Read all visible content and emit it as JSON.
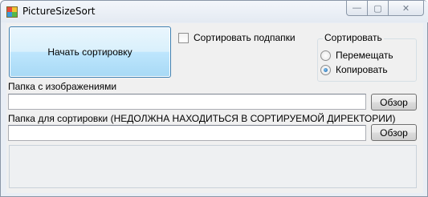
{
  "window": {
    "title": "PictureSizeSort",
    "minimize_glyph": "—",
    "maximize_glyph": "▢",
    "close_glyph": "✕"
  },
  "main": {
    "start_button_label": "Начать сортировку",
    "sort_subfolders_label": "Сортировать подпапки",
    "sort_subfolders_checked": false,
    "mode_group": {
      "legend": "Сортировать",
      "options": [
        {
          "label": "Перемещать",
          "checked": false
        },
        {
          "label": "Копировать",
          "checked": true
        }
      ]
    },
    "images_folder_label": "Папка с изображениями",
    "images_folder_value": "",
    "images_browse_label": "Обзор",
    "sort_folder_label": "Папка для сортировки (НЕДОЛЖНА НАХОДИТЬСЯ В  СОРТИРУЕМОЙ ДИРЕКТОРИИ)",
    "sort_folder_value": "",
    "sort_browse_label": "Обзор"
  },
  "colors": {
    "accent": "#3c7fb1",
    "icon_colors": [
      "#e8493a",
      "#f2c230",
      "#3a9ad9",
      "#55b84a"
    ]
  }
}
